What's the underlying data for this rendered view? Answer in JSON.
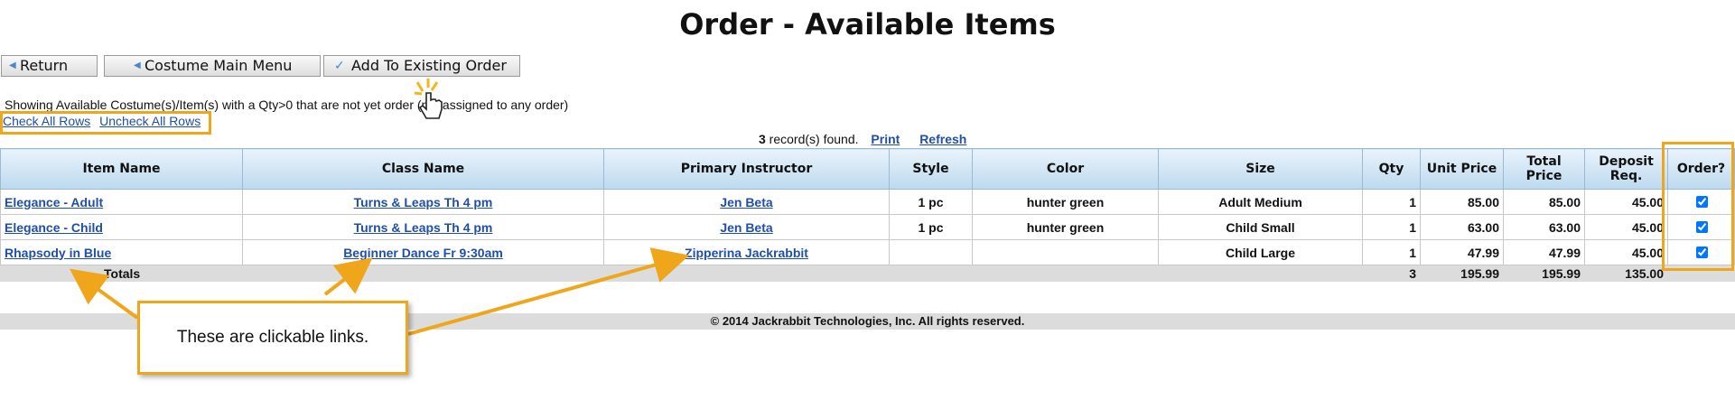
{
  "page": {
    "title": "Order - Available Items"
  },
  "toolbar": {
    "return_label": "Return",
    "main_menu_label": "Costume Main Menu",
    "add_existing_label": "Add To Existing Order"
  },
  "info": {
    "text": "Showing Available Costume(s)/Item(s) with a Qty>0 that are not yet order    (not assigned to any order)",
    "check_all": "Check All Rows",
    "uncheck_all": "Uncheck All Rows"
  },
  "records": {
    "count": "3",
    "found_text": " record(s) found.",
    "print": "Print",
    "refresh": "Refresh"
  },
  "table": {
    "headers": {
      "item_name": "Item Name",
      "class_name": "Class Name",
      "primary_instructor": "Primary Instructor",
      "style": "Style",
      "color": "Color",
      "size": "Size",
      "qty": "Qty",
      "unit_price": "Unit Price",
      "total_price": "Total Price",
      "deposit_line1": "Deposit",
      "deposit_line2": "Req.",
      "order": "Order?"
    },
    "rows": [
      {
        "item_name": "Elegance - Adult",
        "class_name": "Turns & Leaps Th 4 pm",
        "instructor": "Jen Beta",
        "style": "1 pc",
        "color": "hunter green",
        "size": "Adult Medium",
        "qty": "1",
        "unit_price": "85.00",
        "total_price": "85.00",
        "deposit": "45.00",
        "checked": true
      },
      {
        "item_name": "Elegance - Child",
        "class_name": "Turns & Leaps Th 4 pm",
        "instructor": "Jen Beta",
        "style": "1 pc",
        "color": "hunter green",
        "size": "Child Small",
        "qty": "1",
        "unit_price": "63.00",
        "total_price": "63.00",
        "deposit": "45.00",
        "checked": true
      },
      {
        "item_name": "Rhapsody in Blue",
        "class_name": "Beginner Dance Fr 9:30am",
        "instructor": "Zipperina Jackrabbit",
        "style": "",
        "color": "",
        "size": "Child Large",
        "qty": "1",
        "unit_price": "47.99",
        "total_price": "47.99",
        "deposit": "45.00",
        "checked": true
      }
    ],
    "totals": {
      "label": "Totals",
      "qty": "3",
      "unit_price": "195.99",
      "total_price": "195.99",
      "deposit": "135.00"
    }
  },
  "footer": {
    "text": "© 2014  Jackrabbit Technologies, Inc.    All rights reserved."
  },
  "annotation": {
    "callout_text": "These are clickable links."
  },
  "colors": {
    "highlight": "#f0a61a",
    "link": "#1f4fa8",
    "header_gradient_top": "#e9f3fb",
    "header_gradient_bottom": "#bcd9ef",
    "totals_bg": "#dcdcdc"
  },
  "icons": {
    "back_caret": "caret-left-icon",
    "checkmark": "checkmark-icon",
    "cursor": "hand-pointer-icon"
  }
}
